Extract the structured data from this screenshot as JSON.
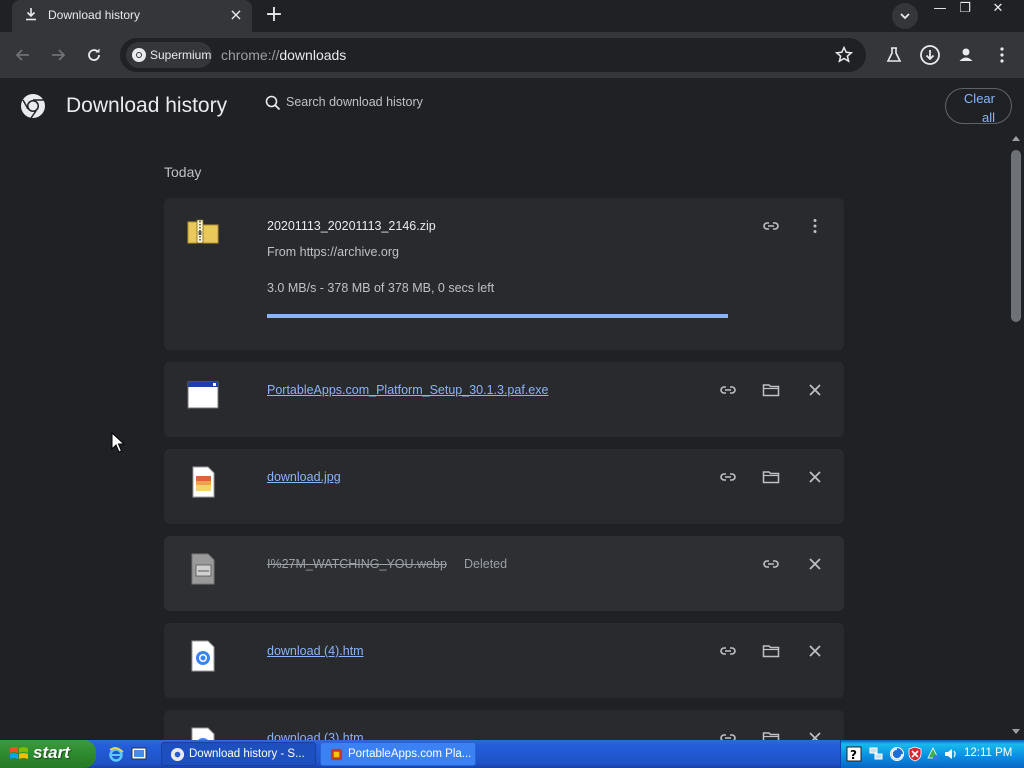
{
  "tab": {
    "title": "Download history",
    "close": "×"
  },
  "newtab_label": "+",
  "window_controls": {
    "minimize": "—",
    "restore": "❐",
    "close": "✕"
  },
  "omnibox": {
    "chip_label": "Supermium",
    "url_scheme": "chrome://",
    "url_host": "downloads"
  },
  "header": {
    "title": "Download history",
    "search_placeholder": "Search download history",
    "clear_all_line1": "Clear",
    "clear_all_line2": "all"
  },
  "section": {
    "label": "Today"
  },
  "downloads": [
    {
      "name": "20201113_20201113_2146.zip",
      "source": "From https://archive.org",
      "status": "3.0 MB/s - 378 MB of 378 MB, 0 secs left",
      "progress": 1.0,
      "icon": "zip-icon"
    },
    {
      "name": "PortableApps.com_Platform_Setup_30.1.3.paf.exe",
      "icon": "exe-window-icon"
    },
    {
      "name": "download.jpg",
      "icon": "jpg-image-icon"
    },
    {
      "name": "I%27M_WATCHING_YOU.webp",
      "status_tag": "Deleted",
      "icon": "webp-file-icon"
    },
    {
      "name": "download (4).htm",
      "icon": "chrome-htm-icon"
    },
    {
      "name": "download (3).htm",
      "icon": "chrome-htm-icon"
    }
  ],
  "taskbar": {
    "start_label": "start",
    "tasks": [
      {
        "label": "Download history - S..."
      },
      {
        "label": "PortableApps.com Pla..."
      }
    ],
    "clock": "12:11 PM"
  },
  "colors": {
    "page_bg": "#202124",
    "card_bg": "#292a2d",
    "link": "#8ab4f8",
    "progress": "#8ab4f8"
  }
}
